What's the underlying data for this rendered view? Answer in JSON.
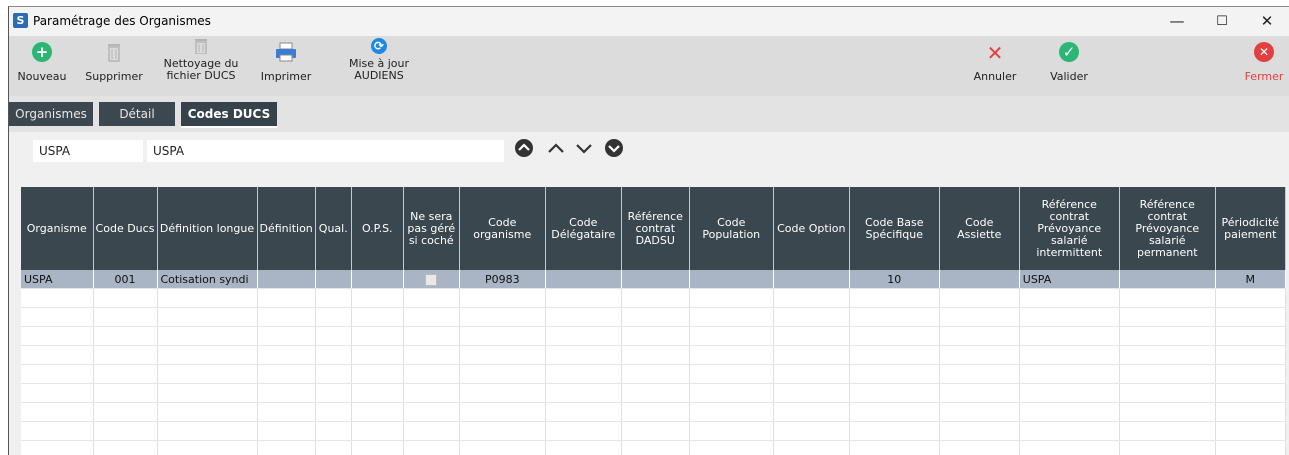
{
  "window": {
    "title": "Paramétrage des Organismes",
    "app_letter": "S",
    "minimize": "—",
    "maximize": "☐",
    "close": "✕"
  },
  "toolbar": {
    "nouveau": "Nouveau",
    "supprimer": "Supprimer",
    "nettoyage_1": "Nettoyage du",
    "nettoyage_2": "fichier DUCS",
    "imprimer": "Imprimer",
    "maj_1": "Mise à jour",
    "maj_2": "AUDIENS",
    "annuler": "Annuler",
    "valider": "Valider",
    "fermer": "Fermer"
  },
  "tabs": [
    {
      "label": "Organismes"
    },
    {
      "label": "Détail"
    },
    {
      "label": "Codes DUCS"
    }
  ],
  "filters": {
    "code": "USPA",
    "name": "USPA"
  },
  "grid": {
    "headers": [
      "Organisme",
      "Code Ducs",
      "Définition longue",
      "Définition",
      "Qual.",
      "O.P.S.",
      "Ne sera pas géré si coché",
      "Code organisme",
      "Code Délégataire",
      "Référence contrat DADSU",
      "Code Population",
      "Code Option",
      "Code Base Spécifique",
      "Code Assiette",
      "Référence contrat Prévoyance salarié intermittent",
      "Référence contrat Prévoyance salarié permanent",
      "Périodicité paiement"
    ],
    "rows": [
      [
        "USPA",
        "001",
        "Cotisation syndi",
        "",
        "",
        "",
        "",
        "P0983",
        "",
        "",
        "",
        "",
        "10",
        "",
        "USPA",
        "",
        "M"
      ]
    ]
  },
  "colors": {
    "accent_dark": "#3b474e",
    "selected_row": "#a9b4c5",
    "green": "#2bb673",
    "red": "#e04040",
    "blue": "#1e88e5"
  }
}
